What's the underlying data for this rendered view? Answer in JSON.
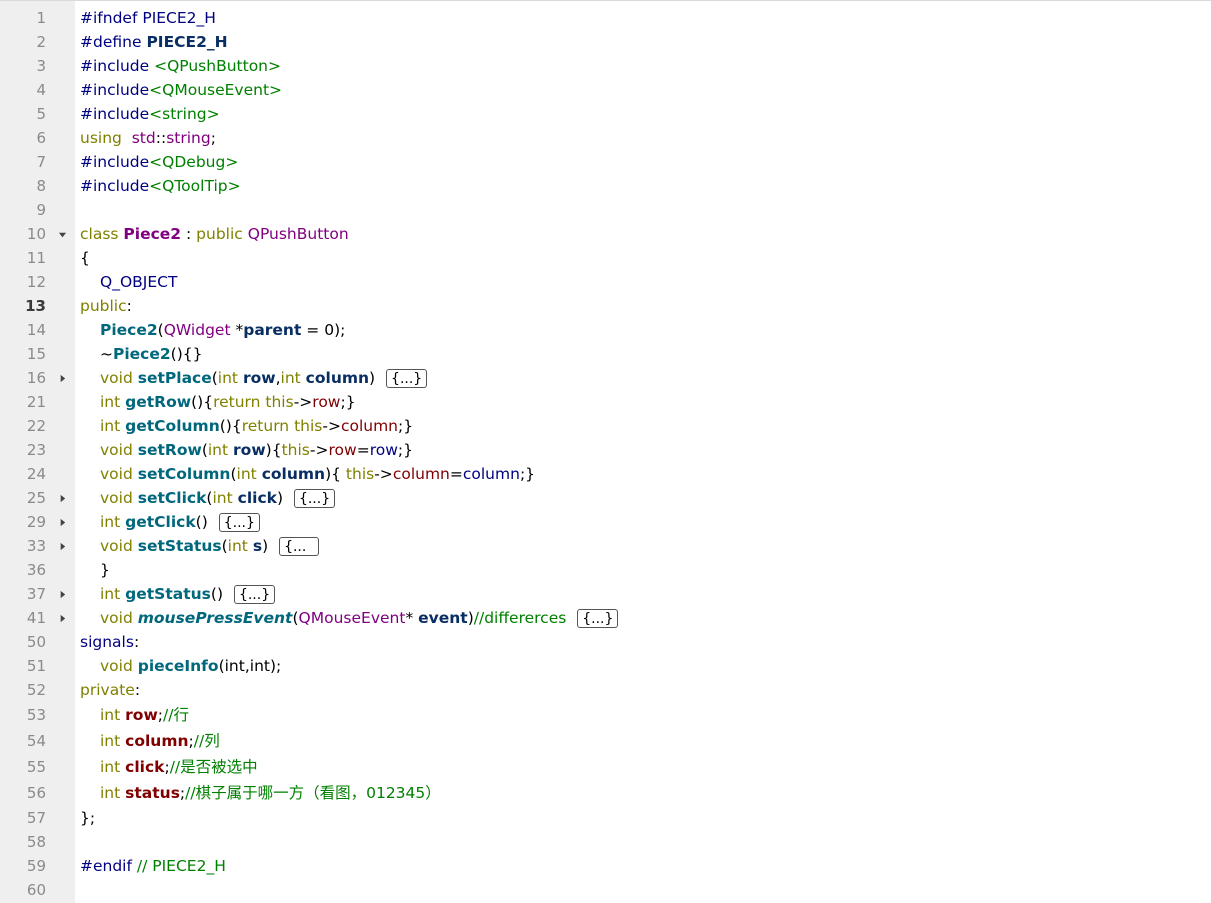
{
  "editor": {
    "line_numbers": [
      "1",
      "2",
      "3",
      "4",
      "5",
      "6",
      "7",
      "8",
      "9",
      "10",
      "11",
      "12",
      "13",
      "14",
      "15",
      "16",
      "21",
      "22",
      "23",
      "24",
      "25",
      "29",
      "33",
      "36",
      "37",
      "41",
      "50",
      "51",
      "52",
      "53",
      "54",
      "55",
      "56",
      "57",
      "58",
      "59",
      "60"
    ],
    "current_line": "13",
    "collapsed_marker": "{...}",
    "collapsed_marker_partial": "{...",
    "tokens": {
      "ifndef": "#ifndef",
      "define": "#define",
      "include": "#include",
      "endif": "#endif",
      "guard": "PIECE2_H",
      "guard_comment": "// PIECE2_H",
      "qpushbutton_inc": "<QPushButton>",
      "qmouseevent_inc": "<QMouseEvent>",
      "string_inc": "<string>",
      "qdebug_inc": "<QDebug>",
      "qtooltip_inc": "<QToolTip>",
      "using": "using",
      "std": "std",
      "scope": "::",
      "string": "string",
      "semi": ";",
      "class": "class",
      "class_name": "Piece2",
      "colon_space": " : ",
      "public": "public",
      "qpushbutton": "QPushButton",
      "open_brace": "{",
      "close_brace": "}",
      "q_object": "Q_OBJECT",
      "public_label": "public",
      "colon": ":",
      "signals_label": "signals",
      "private_label": "private",
      "qwidget": "QWidget",
      "star_space": " *",
      "parent": "parent",
      "eq_zero": " = 0);",
      "paren_open": "(",
      "tilde": "~",
      "dtor_tail": "(){}",
      "void": "void",
      "int": "int",
      "set_place": "setPlace",
      "get_row": "getRow",
      "get_column": "getColumn",
      "set_row": "setRow",
      "set_column": "setColumn",
      "set_click": "setClick",
      "get_click": "getClick",
      "set_status": "setStatus",
      "get_status": "getStatus",
      "mouse_press_event": "mousePressEvent",
      "piece_info": "pieceInfo",
      "qmouseevent": "QMouseEvent",
      "star_space2": "* ",
      "event": "event",
      "row": "row",
      "column": "column",
      "click": "click",
      "status": "status",
      "s": "s",
      "comma": ",",
      "paren_close_sp": ")",
      "empty_parens": "()",
      "return": "return",
      "this": "this",
      "arrow": "->",
      "eq": "=",
      "brace_open_sp": "{",
      "close_semi_brace": ";}",
      "brace_space": "{ ",
      "differerces": "//differerces",
      "cm_row": "//行",
      "cm_column": "//列",
      "cm_click": "//是否被选中",
      "cm_status": "//棋子属于哪一方（看图，012345）",
      "piece_info_args": "(int,int);",
      "class_end": "};"
    }
  }
}
